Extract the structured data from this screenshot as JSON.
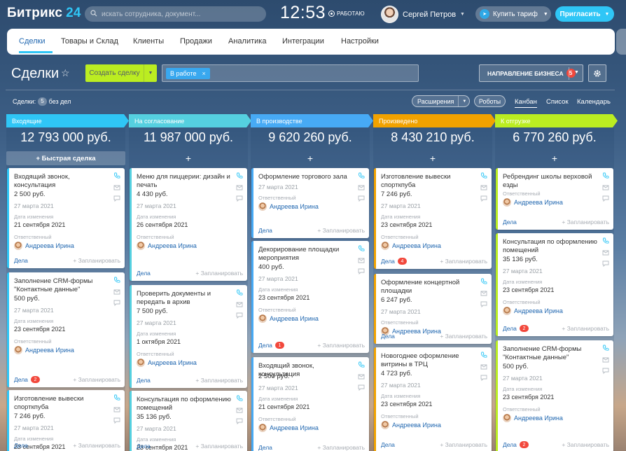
{
  "header": {
    "logo": "Битрикс",
    "logo_num": "24",
    "search_placeholder": "искать сотрудника, документ...",
    "clock": "12:53",
    "work_status": "работаю",
    "user_name": "Сергей Петров",
    "buy_label": "Купить тариф",
    "invite_label": "Пригласить"
  },
  "nav": {
    "tabs": [
      "Сделки",
      "Товары и Склад",
      "Клиенты",
      "Продажи",
      "Аналитика",
      "Интеграции",
      "Настройки"
    ]
  },
  "toolbar": {
    "title": "Сделки",
    "create_label": "Создать сделку",
    "filter_chip": "В работе",
    "direction_label": "Направление бизнеса",
    "direction_badge": "5"
  },
  "views": {
    "deals_label": "Сделки:",
    "deals_count": "5",
    "no_deals": "без дел",
    "extensions": "Расширения",
    "robots": "Роботы",
    "kanban": "Канбан",
    "list": "Список",
    "calendar": "Календарь"
  },
  "common": {
    "quick_deal": "+ Быстрая сделка",
    "plus": "+",
    "changed": "Дата изменения",
    "responsible": "Ответственный",
    "deals": "Дела",
    "plan": "+ Запланировать",
    "person": "Андреева Ирина"
  },
  "colors": {
    "stage1": "#2fc6f6",
    "stage2": "#55d0e0",
    "stage3": "#47aaf5",
    "stage4": "#f1a200",
    "stage5": "#bbed21"
  },
  "stages": [
    {
      "name": "Входящие",
      "sum": "12 793 000 руб."
    },
    {
      "name": "На согласование",
      "sum": "11 987 000 руб."
    },
    {
      "name": "В производстве",
      "sum": "9 620 260 руб."
    },
    {
      "name": "Произведено",
      "sum": "8 430 210 руб."
    },
    {
      "name": "К отгрузке",
      "sum": "6 770 260 руб."
    }
  ],
  "cards": [
    [
      {
        "title": "Входящий звонок, консультация",
        "price": "2 500 руб.",
        "date": "27 марта 2021",
        "modified": "21 сентября 2021",
        "badge": ""
      },
      {
        "title": "Заполнение CRM-формы \"Контактные данные\"",
        "price": "500 руб.",
        "date": "27 марта 2021",
        "modified": "23 сентября 2021",
        "badge": "2"
      },
      {
        "title": "Изготовление вывески спорткпуба",
        "price": "7 246 руб.",
        "date": "27 марта 2021",
        "modified": "23 сентября 2021",
        "badge": ""
      }
    ],
    [
      {
        "title": "Меню для пиццерии: дизайн и печать",
        "price": "4 430 руб.",
        "date": "27 марта 2021",
        "modified": "26 сентября 2021",
        "badge": ""
      },
      {
        "title": "Проверить документы и передать в архив",
        "price": "7 500 руб.",
        "date": "27 марта 2021",
        "modified": "1 октября 2021",
        "badge": ""
      },
      {
        "title": "Консультация по оформлению помещений",
        "price": "35 136 руб.",
        "date": "27 марта 2021",
        "modified": "23 сентября 2021",
        "badge": ""
      }
    ],
    [
      {
        "title": "Оформление торгового зала",
        "price": "",
        "date": "27 марта 2021",
        "modified": "",
        "badge": ""
      },
      {
        "title": "Декорирование площадки мероприятия",
        "price": "400 руб.",
        "date": "27 марта 2021",
        "modified": "23 сентября 2021",
        "badge": "1"
      },
      {
        "title": "Входящий звонок, консультация",
        "price": "2 500 руб.",
        "date": "27 марта 2021",
        "modified": "21 сентября 2021",
        "badge": ""
      }
    ],
    [
      {
        "title": "Изготовление вывески спорткпуба",
        "price": "7 246 руб.",
        "date": "27 марта 2021",
        "modified": "23 сентября 2021",
        "badge": "4"
      },
      {
        "title": "Оформление концертной площадки",
        "price": "6 247 руб.",
        "date": "27 марта 2021",
        "modified": "",
        "badge": ""
      },
      {
        "title": "Новогоднее оформление витрины в ТРЦ",
        "price": "4 723 руб.",
        "date": "27 марта 2021",
        "modified": "23 сентября 2021",
        "badge": ""
      }
    ],
    [
      {
        "title": "Ребрендинг школы верховой езды",
        "price": "",
        "date": "",
        "modified": "",
        "badge": ""
      },
      {
        "title": "Консультация по оформлению помещений",
        "price": "35 136 руб.",
        "date": "27 марта 2021",
        "modified": "23 сентября 2021",
        "badge": "2"
      },
      {
        "title": "Заполнение CRM-формы \"Контактные данные\"",
        "price": "500 руб.",
        "date": "27 марта 2021",
        "modified": "23 сентября 2021",
        "badge": "2"
      }
    ]
  ]
}
